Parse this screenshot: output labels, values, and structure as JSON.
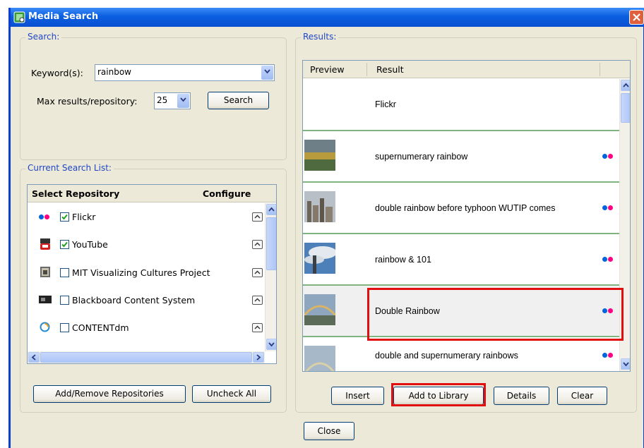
{
  "window": {
    "title": "Media Search"
  },
  "search_group": {
    "label": "Search:",
    "keyword_label": "Keyword(s):",
    "keyword_value": "rainbow",
    "max_label": "Max results/repository:",
    "max_value": "25",
    "search_button": "Search"
  },
  "search_list": {
    "label": "Current Search List:",
    "header_repo": "Select Repository",
    "header_configure": "Configure",
    "repositories": [
      {
        "name": "Flickr",
        "checked": true,
        "icon": "flickr-icon"
      },
      {
        "name": "YouTube",
        "checked": true,
        "icon": "youtube-icon"
      },
      {
        "name": "MIT Visualizing Cultures Project",
        "checked": false,
        "icon": "mit-vc-icon"
      },
      {
        "name": "Blackboard Content System",
        "checked": false,
        "icon": "blackboard-icon"
      },
      {
        "name": "CONTENTdm",
        "checked": false,
        "icon": "contentdm-icon"
      }
    ],
    "add_remove_button": "Add/Remove Repositories",
    "uncheck_all_button": "Uncheck All"
  },
  "results": {
    "label": "Results:",
    "col_preview": "Preview",
    "col_result": "Result",
    "rows": [
      {
        "text": "Flickr",
        "has_thumb": false,
        "source_icon": ""
      },
      {
        "text": "supernumerary rainbow",
        "has_thumb": true,
        "source_icon": "flickr-icon"
      },
      {
        "text": "double rainbow before typhoon WUTIP comes",
        "has_thumb": true,
        "source_icon": "flickr-icon"
      },
      {
        "text": "rainbow & 101",
        "has_thumb": true,
        "source_icon": "flickr-icon"
      },
      {
        "text": "Double Rainbow",
        "has_thumb": true,
        "source_icon": "flickr-icon",
        "selected": true
      },
      {
        "text": "double and supernumerary rainbows",
        "has_thumb": true,
        "source_icon": "flickr-icon"
      }
    ],
    "insert_button": "Insert",
    "add_library_button": "Add to Library",
    "details_button": "Details",
    "clear_button": "Clear"
  },
  "footer": {
    "close_button": "Close"
  },
  "colors": {
    "title_bar": "#0a5fe0",
    "group_label": "#1f46c8",
    "highlight": "#e01010",
    "flickr_blue": "#0063dc",
    "flickr_pink": "#ff0084",
    "row_separator": "#7fb37f"
  }
}
